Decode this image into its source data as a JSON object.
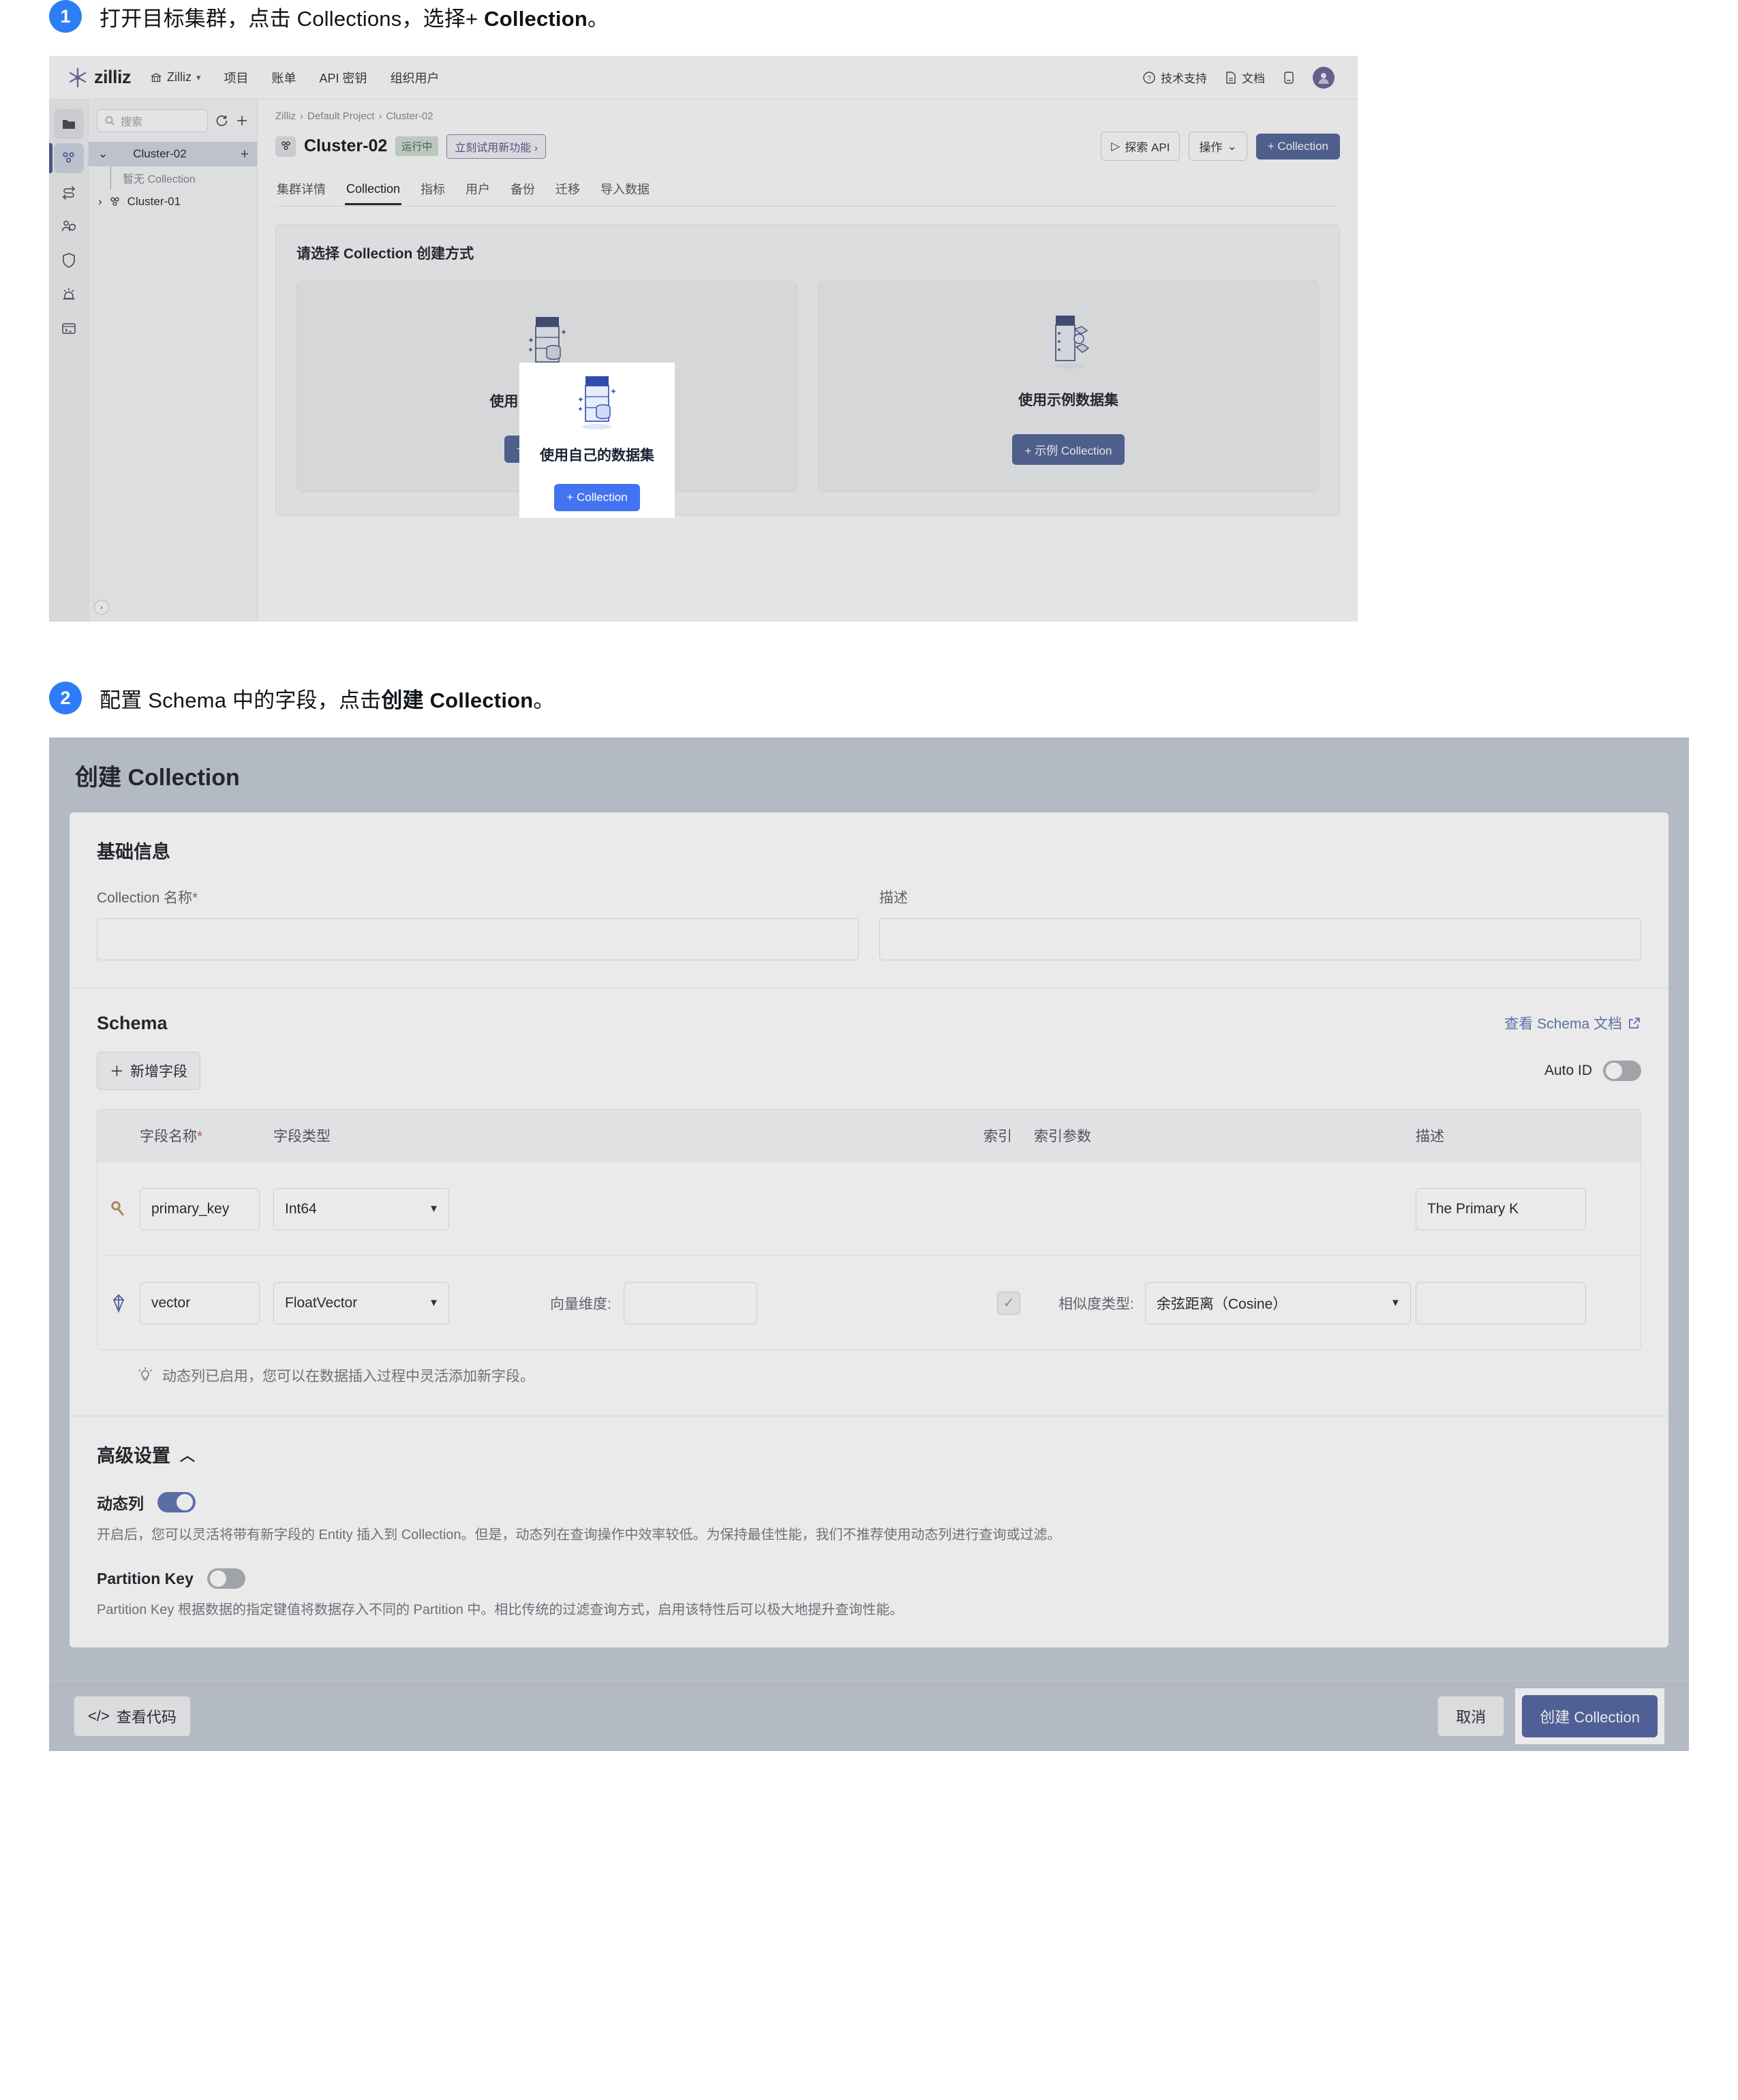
{
  "steps": [
    {
      "num": "1",
      "text_before": "打开目标集群，点击 Collections，选择+ ",
      "text_bold": "Collection",
      "text_after": "。"
    },
    {
      "num": "2",
      "text_before": "配置 Schema 中的字段，点击",
      "text_bold": "创建 Collection",
      "text_after": "。"
    }
  ],
  "app": {
    "brand": "zilliz",
    "org": "Zilliz",
    "topnav": [
      "项目",
      "账单",
      "API 密钥",
      "组织用户"
    ],
    "top_right": {
      "support": "技术支持",
      "docs": "文档"
    },
    "rail_icons": [
      "folder-icon",
      "cluster-icon",
      "migration-icon",
      "user-access-icon",
      "shield-icon",
      "alert-icon",
      "console-icon"
    ],
    "tree": {
      "search_placeholder": "搜索",
      "refresh_icon": "refresh-icon",
      "add_icon": "plus-icon",
      "nodes": [
        {
          "label": "Cluster-02",
          "expanded": true,
          "active": true,
          "child": "暂无 Collection"
        },
        {
          "label": "Cluster-01",
          "expanded": false,
          "active": false
        }
      ]
    },
    "breadcrumb": [
      "Zilliz",
      "Default Project",
      "Cluster-02"
    ],
    "cluster": {
      "name": "Cluster-02",
      "status": "运行中",
      "promo": "立刻试用新功能 ›"
    },
    "head_actions": {
      "explore_api": "探索 API",
      "operations": "操作",
      "add_collection": "+ Collection"
    },
    "tabs": [
      "集群详情",
      "Collection",
      "指标",
      "用户",
      "备份",
      "迁移",
      "导入数据"
    ],
    "active_tab": "Collection",
    "panel": {
      "title": "请选择 Collection 创建方式",
      "cards": [
        {
          "label": "使用自己的数据集",
          "button": "+ Collection",
          "highlighted": true
        },
        {
          "label": "使用示例数据集",
          "button": "+ 示例 Collection",
          "highlighted": false
        }
      ]
    }
  },
  "modal": {
    "title": "创建 Collection",
    "basic": {
      "section_title": "基础信息",
      "name_label": "Collection 名称",
      "name_required": "*",
      "name_value": "",
      "desc_label": "描述",
      "desc_value": ""
    },
    "schema": {
      "section_title": "Schema",
      "doc_link": "查看 Schema 文档",
      "add_field_button": "新增字段",
      "auto_id_label": "Auto ID",
      "auto_id_on": false,
      "columns": {
        "name": "字段名称",
        "name_required": "*",
        "type": "字段类型",
        "index": "索引",
        "index_param": "索引参数",
        "desc": "描述"
      },
      "rows": [
        {
          "icon": "key-icon",
          "name": "primary_key",
          "type": "Int64",
          "desc": "The Primary K"
        },
        {
          "icon": "vector-icon",
          "name": "vector",
          "type": "FloatVector",
          "dim_label": "向量维度:",
          "dim_value": "",
          "indexed": true,
          "metric_label": "相似度类型:",
          "metric_value": "余弦距离（Cosine）",
          "desc": ""
        }
      ],
      "tip": "动态列已启用，您可以在数据插入过程中灵活添加新字段。"
    },
    "advanced": {
      "section_title": "高级设置",
      "collapsed": false,
      "items": [
        {
          "name": "动态列",
          "enabled": true,
          "desc": "开启后，您可以灵活将带有新字段的 Entity 插入到 Collection。但是，动态列在查询操作中效率较低。为保持最佳性能，我们不推荐使用动态列进行查询或过滤。"
        },
        {
          "name": "Partition Key",
          "enabled": false,
          "desc": "Partition Key 根据数据的指定键值将数据存入不同的 Partition 中。相比传统的过滤查询方式，启用该特性后可以极大地提升查询性能。"
        }
      ]
    },
    "footer": {
      "view_code": "查看代码",
      "cancel": "取消",
      "create": "创建 Collection"
    }
  },
  "colors": {
    "accent_blue": "#3a63d8",
    "highlight_blue": "#4273f0",
    "step_badge": "#2f7df6",
    "status_green_bg": "#bfe3cf",
    "key_orange": "#e0892a"
  }
}
